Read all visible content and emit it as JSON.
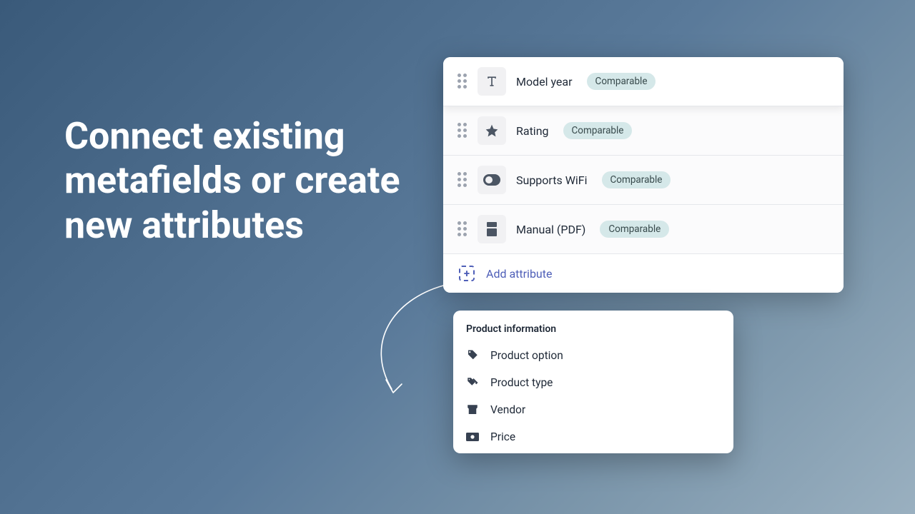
{
  "headline": "Connect existing metafields or create new attributes",
  "attributes": [
    {
      "label": "Model year",
      "badge": "Comparable",
      "icon": "text"
    },
    {
      "label": "Rating",
      "badge": "Comparable",
      "icon": "star"
    },
    {
      "label": "Supports WiFi",
      "badge": "Comparable",
      "icon": "toggle"
    },
    {
      "label": "Manual (PDF)",
      "badge": "Comparable",
      "icon": "file"
    }
  ],
  "add_label": "Add attribute",
  "dropdown": {
    "header": "Product information",
    "items": [
      {
        "label": "Product option",
        "icon": "tag"
      },
      {
        "label": "Product type",
        "icon": "tag-swap"
      },
      {
        "label": "Vendor",
        "icon": "store"
      },
      {
        "label": "Price",
        "icon": "money"
      }
    ]
  }
}
